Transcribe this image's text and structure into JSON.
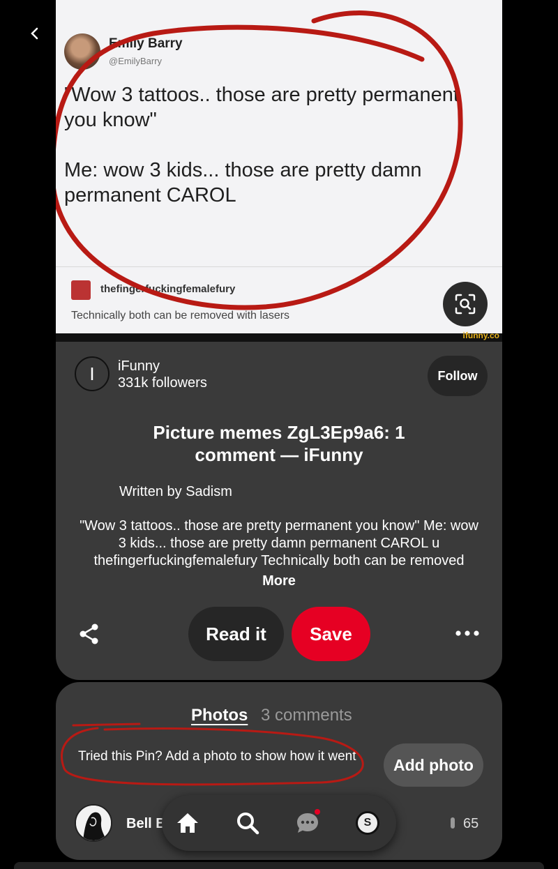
{
  "nav": {
    "back_icon": "chevron-left-icon"
  },
  "pin_image": {
    "tweet_name": "Emily Barry",
    "tweet_handle": "@EmilyBarry",
    "tweet_body": "\"Wow 3 tattoos.. those are pretty permanent you know\"\n\nMe: wow 3 kids... those are pretty damn permanent CAROL",
    "reply_user": "thefingerfuckingfemalefury",
    "reply_text": "Technically both can be removed with lasers",
    "watermark": "ifunny.co",
    "annotation_color": "#b81a14"
  },
  "creator": {
    "avatar_letter": "I",
    "name": "iFunny",
    "followers": "331k followers",
    "follow_label": "Follow"
  },
  "pin": {
    "title": "Picture memes ZgL3Ep9a6: 1 comment — iFunny",
    "written_by": "Written by Sadism",
    "description": "\"Wow 3 tattoos.. those are pretty permanent you know\" Me: wow 3 kids... those are pretty damn permanent CAROL u thefingerfuckingfemalefury Technically both can be removed",
    "more_label": "More"
  },
  "actions": {
    "read_label": "Read it",
    "save_label": "Save",
    "save_color": "#e60023"
  },
  "comments": {
    "tab_photos": "Photos",
    "tab_comments": "3 comments",
    "tried_text": "Tried this Pin? Add a photo to show how it went",
    "add_photo_label": "Add photo",
    "commenter_name": "Bell B",
    "like_count": "65"
  },
  "bottom_nav": {
    "profile_letter": "S",
    "items": [
      "home-icon",
      "search-icon",
      "messages-icon",
      "profile-icon"
    ]
  }
}
